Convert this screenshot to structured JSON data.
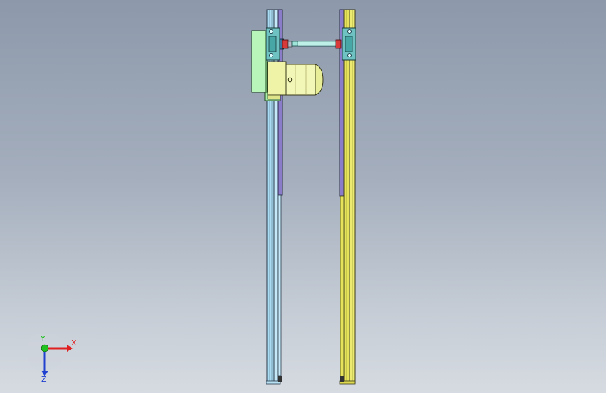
{
  "viewport": {
    "colors": {
      "background_top": "#8d99ab",
      "background_bottom": "#d6dbe1",
      "left_frame": "#a9dcf2",
      "right_frame": "#e6e35a",
      "motor_body": "#eef3a8",
      "motor_mount": "#a8f0a8",
      "shaft": "#9fe4d8",
      "coupling": "#d83a3a",
      "bearing": "#47a6a6",
      "plate_purple": "#8a7cc8"
    }
  },
  "triad": {
    "x_label": "X",
    "y_label": "Y",
    "z_label": "Z",
    "x_color": "#e02020",
    "y_color": "#20c020",
    "z_color": "#2040d0"
  }
}
